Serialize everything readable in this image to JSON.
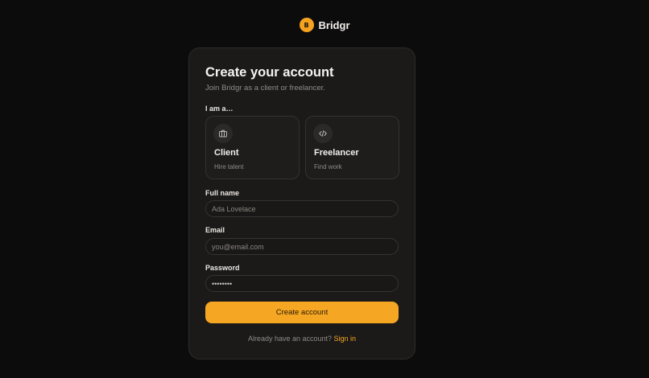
{
  "brand": {
    "logo_letter": "B",
    "name": "Bridgr",
    "accent": "#f5a623"
  },
  "form": {
    "title": "Create your account",
    "subtitle": "Join Bridgr as a client or freelancer.",
    "role_label": "I am a…",
    "roles": [
      {
        "title": "Client",
        "desc": "Hire talent",
        "icon": "briefcase-icon"
      },
      {
        "title": "Freelancer",
        "desc": "Find work",
        "icon": "code-icon"
      }
    ],
    "full_name": {
      "label": "Full name",
      "placeholder": "Ada Lovelace"
    },
    "email": {
      "label": "Email",
      "placeholder": "you@email.com"
    },
    "password": {
      "label": "Password",
      "value": "••••••••"
    },
    "submit_label": "Create account",
    "footer_text": "Already have an account?",
    "signin_label": "Sign in"
  }
}
